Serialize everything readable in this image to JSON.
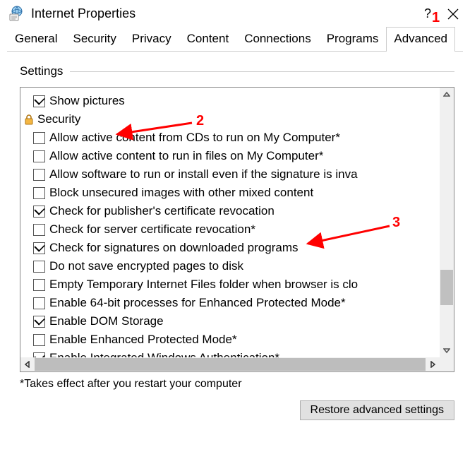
{
  "window": {
    "title": "Internet Properties",
    "help_symbol": "?",
    "close_label": "Close"
  },
  "tabs": [
    "General",
    "Security",
    "Privacy",
    "Content",
    "Connections",
    "Programs",
    "Advanced"
  ],
  "active_tab_index": 6,
  "group": {
    "title": "Settings"
  },
  "tree": {
    "top_items": [
      {
        "label": "Show pictures",
        "checked": true
      }
    ],
    "category": {
      "label": "Security",
      "icon": "lock-icon"
    },
    "items": [
      {
        "label": "Allow active content from CDs to run on My Computer*",
        "checked": false
      },
      {
        "label": "Allow active content to run in files on My Computer*",
        "checked": false
      },
      {
        "label": "Allow software to run or install even if the signature is inva",
        "checked": false
      },
      {
        "label": "Block unsecured images with other mixed content",
        "checked": false
      },
      {
        "label": "Check for publisher's certificate revocation",
        "checked": true
      },
      {
        "label": "Check for server certificate revocation*",
        "checked": false
      },
      {
        "label": "Check for signatures on downloaded programs",
        "checked": true
      },
      {
        "label": "Do not save encrypted pages to disk",
        "checked": false
      },
      {
        "label": "Empty Temporary Internet Files folder when browser is clo",
        "checked": false
      },
      {
        "label": "Enable 64-bit processes for Enhanced Protected Mode*",
        "checked": false
      },
      {
        "label": "Enable DOM Storage",
        "checked": true
      },
      {
        "label": "Enable Enhanced Protected Mode*",
        "checked": false
      },
      {
        "label": "Enable Integrated Windows Authentication*",
        "checked": true
      }
    ]
  },
  "footnote": "*Takes effect after you restart your computer",
  "buttons": {
    "restore": "Restore advanced settings"
  },
  "annotations": {
    "1": "1",
    "2": "2",
    "3": "3"
  }
}
